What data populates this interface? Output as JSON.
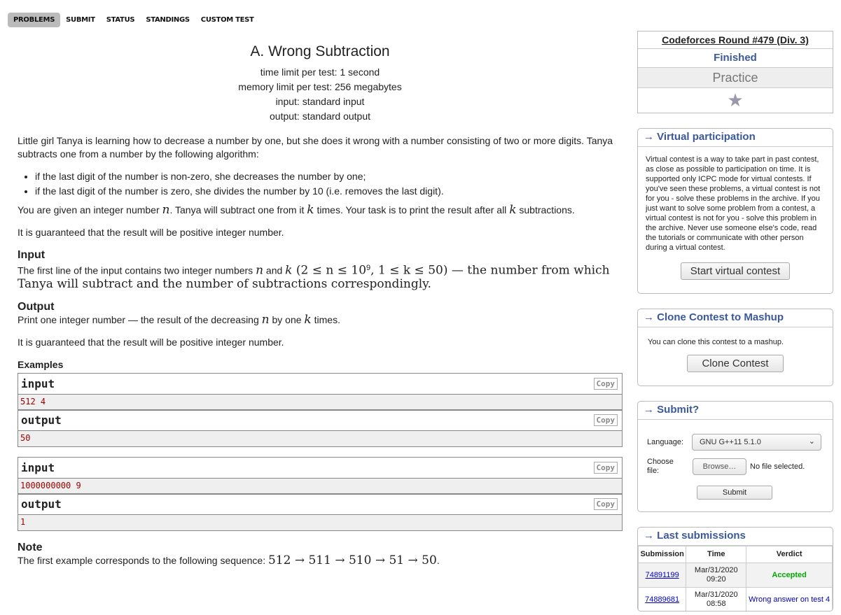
{
  "nav": [
    "PROBLEMS",
    "SUBMIT",
    "STATUS",
    "STANDINGS",
    "CUSTOM TEST"
  ],
  "problem": {
    "title": "A. Wrong Subtraction",
    "limits": [
      "time limit per test: 1 second",
      "memory limit per test: 256 megabytes",
      "input: standard input",
      "output: standard output"
    ],
    "intro": "Little girl Tanya is learning how to decrease a number by one, but she does it wrong with a number consisting of two or more digits. Tanya subtracts one from a number by the following algorithm:",
    "bullets": [
      "if the last digit of the number is non-zero, she decreases the number by one;",
      "if the last digit of the number is zero, she divides the number by 10 (i.e. removes the last digit)."
    ],
    "p2": [
      "You are given an integer number ",
      "n",
      ". Tanya will subtract one from it ",
      "k",
      " times. Your task is to print the result after all ",
      "k",
      " subtractions."
    ],
    "p3": "It is guaranteed that the result will be positive integer number.",
    "input_title": "Input",
    "input_text": [
      "The first line of the input contains two integer numbers ",
      "n",
      " and ",
      "k",
      " (",
      "2 ≤ n ≤ 10",
      "9",
      ", ",
      "1 ≤ k ≤ 50",
      ") — the number from which Tanya will subtract and the number of subtractions correspondingly."
    ],
    "output_title": "Output",
    "output_text": [
      "Print one integer number — the result of the decreasing ",
      "n",
      " by one ",
      "k",
      " times."
    ],
    "output_note": "It is guaranteed that the result will be positive integer number.",
    "examples_title": "Examples",
    "examples": [
      {
        "in": "512 4",
        "out": "50"
      },
      {
        "in": "1000000000 9",
        "out": "1"
      }
    ],
    "input_label": "input",
    "output_label": "output",
    "copy": "Copy",
    "note_title": "Note",
    "note_text": [
      "The first example corresponds to the following sequence: ",
      "512 → 511 → 510 → 51 → 50",
      "."
    ]
  },
  "sidebar": {
    "contest": {
      "name": "Codeforces Round #479 (Div. 3)",
      "status": "Finished",
      "mode": "Practice",
      "icon": "star-icon"
    },
    "virtual": {
      "title": "→ Virtual participation",
      "text": "Virtual contest is a way to take part in past contest, as close as possible to participation on time. It is supported only ICPC mode for virtual contests. If you've seen these problems, a virtual contest is not for you - solve these problems in the archive. If you just want to solve some problem from a contest, a virtual contest is not for you - solve this problem in the archive. Never use someone else's code, read the tutorials or communicate with other person during a virtual contest.",
      "button": "Start virtual contest"
    },
    "clone": {
      "title": "→ Clone Contest to Mashup",
      "text": "You can clone this contest to a mashup.",
      "button": "Clone Contest"
    },
    "submit": {
      "title": "→ Submit?",
      "language_label": "Language:",
      "language": "GNU G++11 5.1.0",
      "file_label": "Choose file:",
      "browse": "Browse…",
      "no_file": "No file selected.",
      "button": "Submit"
    },
    "last": {
      "title": "→ Last submissions",
      "headers": [
        "Submission",
        "Time",
        "Verdict"
      ],
      "rows": [
        {
          "id": "74891199",
          "time": "Mar/31/2020 09:20",
          "verdict": "Accepted",
          "color": "#0a0"
        },
        {
          "id": "74889681",
          "time": "Mar/31/2020 08:58",
          "verdict": "Wrong answer on test 4",
          "color": "#00a"
        }
      ]
    }
  }
}
